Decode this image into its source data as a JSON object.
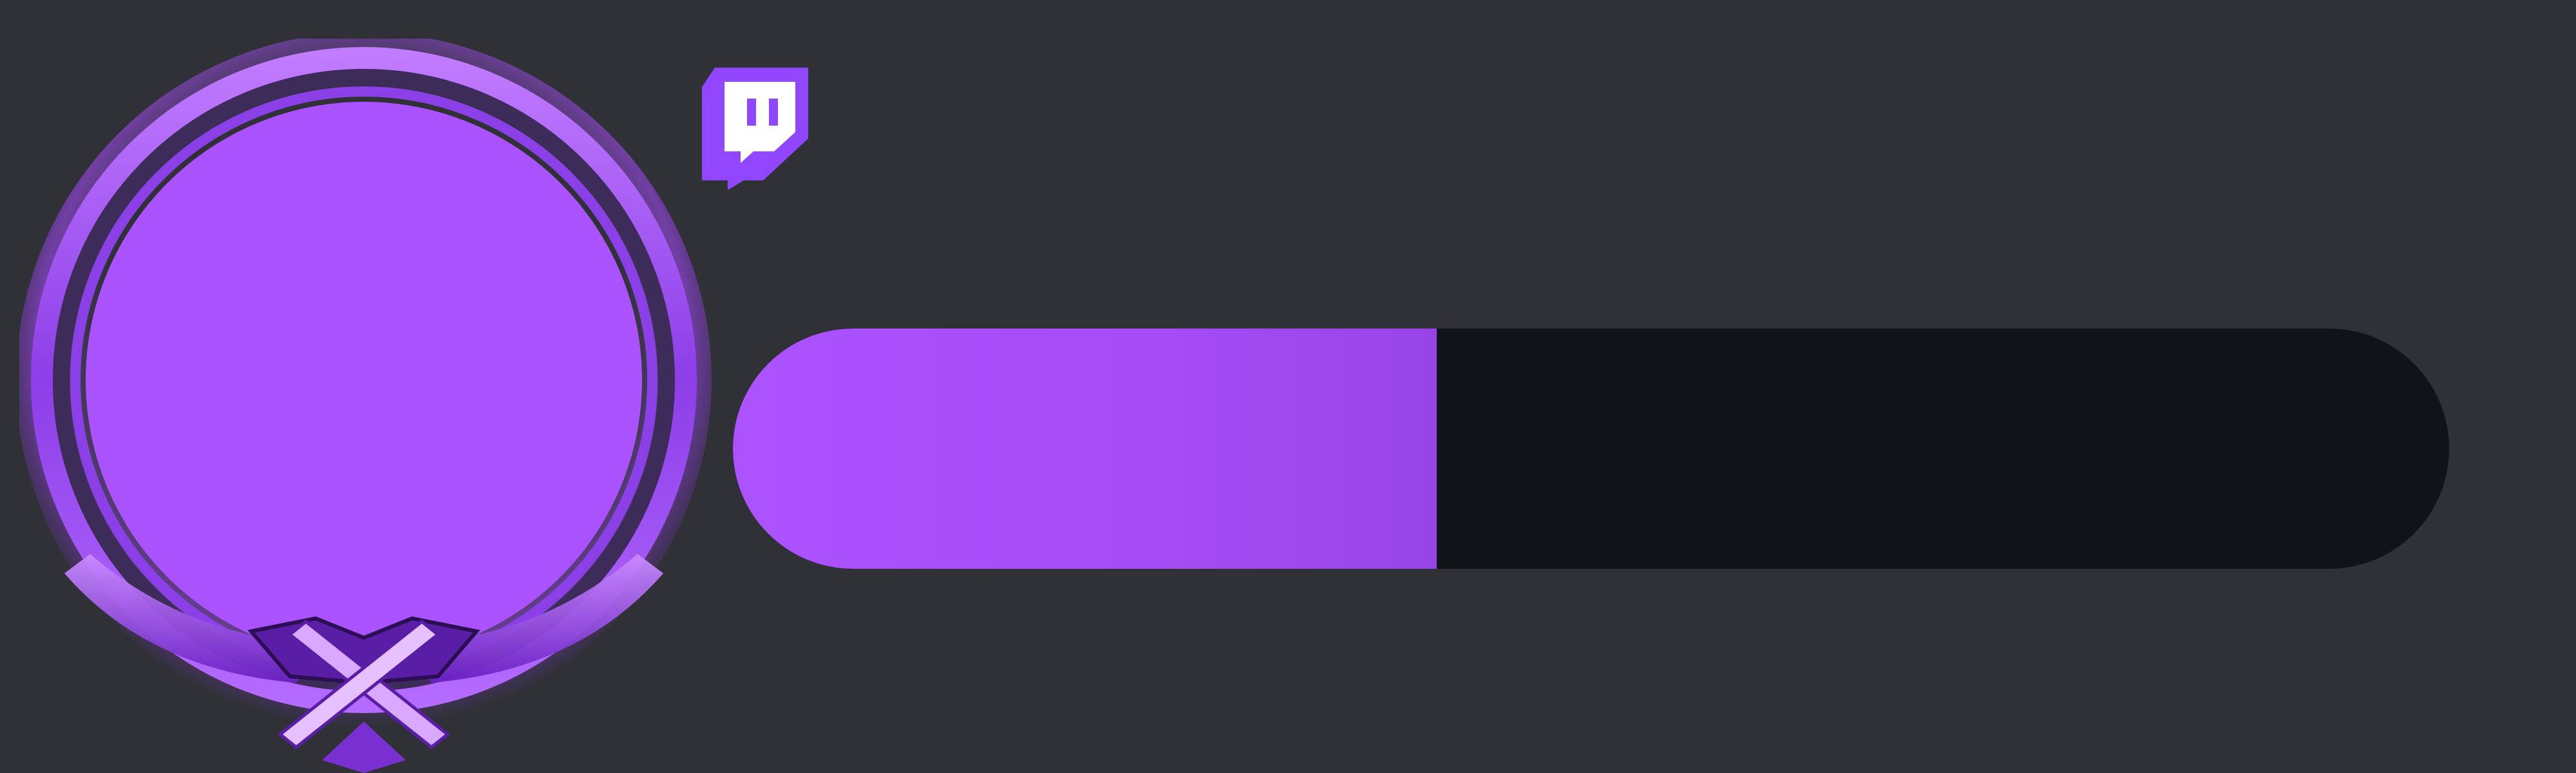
{
  "overlay": {
    "avatar_frame": {
      "icon": "crossed-swords-emblem-icon",
      "accent_color": "#ab52ff",
      "ring_color": "#7a2fd1"
    },
    "platform": {
      "icon": "twitch-icon",
      "color": "#9146ff"
    },
    "progress": {
      "fraction": 0.41,
      "fill_color": "#ac52ff",
      "track_color": "#121316"
    },
    "background_color": "#2f3136"
  }
}
